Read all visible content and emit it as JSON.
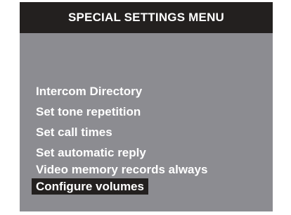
{
  "header": {
    "title": "SPECIAL SETTINGS MENU"
  },
  "menu": {
    "items": [
      {
        "label": "Intercom Directory"
      },
      {
        "label": "Set tone repetition"
      },
      {
        "label": "Set call times"
      },
      {
        "label": "Set automatic reply"
      },
      {
        "label": "Video memory records always"
      },
      {
        "label": "Configure volumes"
      }
    ],
    "selected_label": "Configure volumes"
  },
  "colors": {
    "screen_background": "#8c8c91",
    "title_bar_background": "#23201f",
    "selection_background": "#23201f",
    "text": "#ffffff"
  }
}
